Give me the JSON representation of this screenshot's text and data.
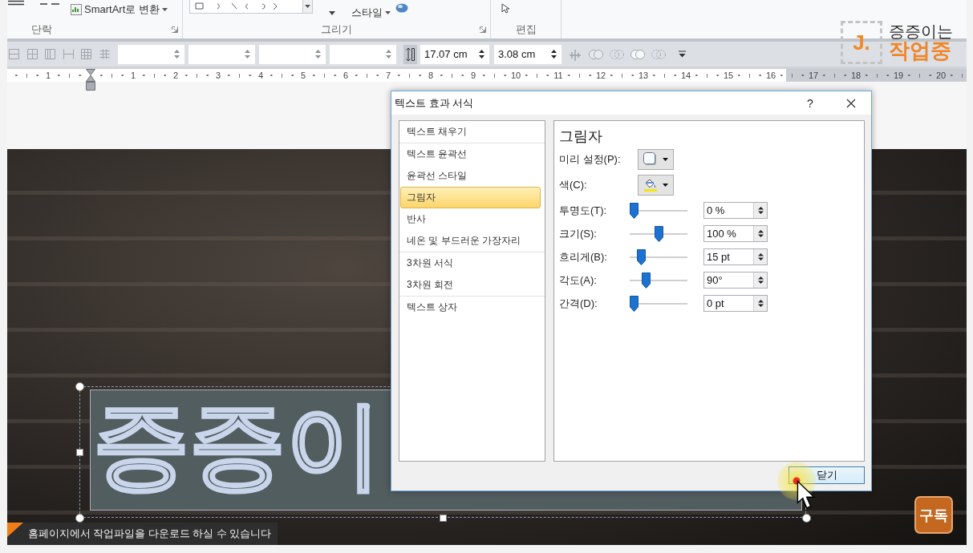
{
  "ribbon": {
    "groups": [
      {
        "label": "단락",
        "launcher": true,
        "command": "SmartArt로 변환"
      },
      {
        "label": "그리기",
        "launcher": true,
        "command": "스타일"
      },
      {
        "label": "편집",
        "launcher": false
      }
    ]
  },
  "size_bar": {
    "fields": [
      {
        "kind": "blank"
      },
      {
        "kind": "blank"
      },
      {
        "kind": "blank"
      },
      {
        "kind": "blank"
      },
      {
        "kind": "height",
        "value": "17.07 cm"
      },
      {
        "kind": "width",
        "value": "3.08 cm"
      }
    ]
  },
  "ruler": {
    "labels": [
      "1",
      "1",
      "2",
      "3",
      "4",
      "5",
      "6",
      "7",
      "8",
      "9",
      "10",
      "11",
      "12",
      "13",
      "14",
      "15",
      "16",
      "17",
      "18",
      "19",
      "20"
    ]
  },
  "channel_logo": {
    "mark": "J.",
    "line_1": "증증이는",
    "line_2": "작업중"
  },
  "dialog": {
    "title": "텍스트 효과 서식",
    "help": "?",
    "sections": [
      {
        "items": [
          {
            "label": "텍스트 채우기",
            "selected": false
          }
        ]
      },
      {
        "items": [
          {
            "label": "텍스트 윤곽선",
            "selected": false
          },
          {
            "label": "윤곽선 스타일",
            "selected": false
          },
          {
            "label": "그림자",
            "selected": true
          },
          {
            "label": "반사",
            "selected": false
          },
          {
            "label": "네온 및 부드러운 가장자리",
            "selected": false
          }
        ]
      },
      {
        "items": [
          {
            "label": "3차원 서식",
            "selected": false
          },
          {
            "label": "3차원 회전",
            "selected": false
          }
        ]
      },
      {
        "items": [
          {
            "label": "텍스트 상자",
            "selected": false
          }
        ]
      }
    ],
    "panel": {
      "heading": "그림자",
      "rows": [
        {
          "kind": "preset",
          "label": "미리 설정(P):"
        },
        {
          "kind": "color",
          "label": "색(C):",
          "color": "#f5e50a"
        },
        {
          "kind": "slider",
          "label": "투명도(T):",
          "level": 0,
          "value": "0 %"
        },
        {
          "kind": "slider",
          "label": "크기(S):",
          "level": 0.5,
          "value": "100 %"
        },
        {
          "kind": "slider",
          "label": "흐리게(B):",
          "level": 0.15,
          "value": "15 pt"
        },
        {
          "kind": "slider",
          "label": "각도(A):",
          "level": 0.25,
          "value": "90°"
        },
        {
          "kind": "slider",
          "label": "간격(D):",
          "level": 0,
          "value": "0 pt"
        }
      ]
    },
    "close_button": "닫기"
  },
  "slide": {
    "text_box": {
      "text": "증증이",
      "selected": true
    },
    "caption": "홈페이지에서 작업파일을 다운로드 하실 수 있습니다",
    "subscribe_button": "구독"
  }
}
